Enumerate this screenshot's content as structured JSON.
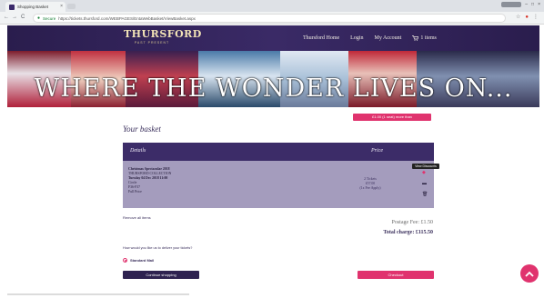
{
  "browser": {
    "tab_title": "Shopping Basket",
    "tab_close": "×",
    "secure_label": "Secure",
    "url": "https://tickets.thursford.com/WEBPAGES/EntaWebBasket/ViewBasket.aspx",
    "user_label": "",
    "back": "←",
    "forward": "→",
    "reload": "C"
  },
  "header": {
    "logo_text": "THURSFORD",
    "logo_sub": "PAST PRESENT",
    "nav": {
      "home": "Thursford Home",
      "login": "Login",
      "account": "My Account",
      "cart": "1 items"
    }
  },
  "hero": {
    "text": "WHERE THE WONDER LIVES ON..."
  },
  "basket": {
    "top_button": "£1.00 (1 seat) more than",
    "title": "Your basket",
    "headers": {
      "details": "Details",
      "price": "Price"
    },
    "item": {
      "line1": "Christmas Spectacular 2018",
      "line2": "THURSFORD COLLECTION",
      "line3": "Tuesday 04 Dec 2018 11:00",
      "line4": "Circle",
      "line5": "F36-F37",
      "line6": "Full Price"
    },
    "price": {
      "line1": "2 Tickets",
      "line2": "£57.00",
      "line3": "(1x Fee Apply)"
    },
    "tooltip": "View Discounts",
    "remove_all": "Remove all items",
    "postage": "Postage Fee: £1.50",
    "total": "Total charge: £115.50"
  },
  "delivery": {
    "question": "How would you like us to deliver your tickets?",
    "option": "Standard Mail"
  },
  "actions": {
    "continue": "Continue shopping",
    "checkout": "Checkout"
  },
  "colors": {
    "brand_purple": "#3c2c68",
    "row_lilac": "#a49cbd",
    "accent_pink": "#e0336e"
  }
}
